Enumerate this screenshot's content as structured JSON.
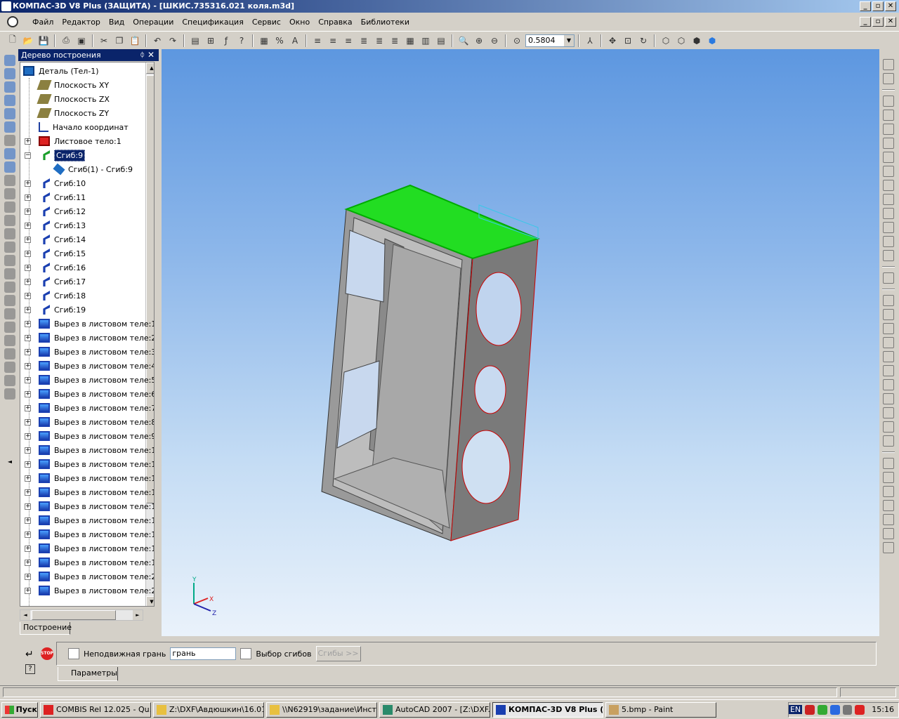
{
  "window": {
    "title": "КОМПАС-3D V8 Plus (ЗАЩИТА) - [ШКИС.735316.021 коля.m3d]",
    "minimize": "_",
    "restore": "▫",
    "close": "✕"
  },
  "menu": [
    "Файл",
    "Редактор",
    "Вид",
    "Операции",
    "Спецификация",
    "Сервис",
    "Окно",
    "Справка",
    "Библиотеки"
  ],
  "toolbar": {
    "zoom_value": "0.5804",
    "icons": [
      "new-icon",
      "open-icon",
      "save-icon",
      "print-icon",
      "preview-icon",
      "cut-icon",
      "copy-icon",
      "paste-icon",
      "undo-icon",
      "redo-icon",
      "properties-icon",
      "tree-icon",
      "variables-icon",
      "help-icon",
      "paste-special-icon",
      "measure-icon",
      "text-icon",
      "zoom-window-icon",
      "zoom-in-icon",
      "zoom-out-icon",
      "zoom-scale-icon",
      "orient-icon",
      "pan-icon",
      "zoom-all-icon",
      "rotate-icon",
      "wireframe-icon",
      "hidden-lines-icon",
      "shaded-icon",
      "shaded-edges-icon"
    ]
  },
  "tree": {
    "title": "Дерево построения",
    "pin": "ᛰ",
    "close": "✕",
    "tab": "Построение",
    "items": [
      {
        "label": "Деталь (Тел-1)",
        "icon": "part",
        "level": 0,
        "exp": ""
      },
      {
        "label": "Плоскость XY",
        "icon": "plane",
        "level": 1,
        "exp": ""
      },
      {
        "label": "Плоскость ZX",
        "icon": "plane",
        "level": 1,
        "exp": ""
      },
      {
        "label": "Плоскость ZY",
        "icon": "plane",
        "level": 1,
        "exp": ""
      },
      {
        "label": "Начало координат",
        "icon": "origin",
        "level": 1,
        "exp": ""
      },
      {
        "label": "Листовое тело:1",
        "icon": "sheet",
        "level": 1,
        "exp": "+"
      },
      {
        "label": "Сгиб:9",
        "icon": "bend-active",
        "level": 1,
        "exp": "−",
        "selected": true
      },
      {
        "label": "Сгиб(1) -  Сгиб:9",
        "icon": "sub",
        "level": 2,
        "exp": ""
      },
      {
        "label": "Сгиб:10",
        "icon": "bend",
        "level": 1,
        "exp": "+"
      },
      {
        "label": "Сгиб:11",
        "icon": "bend",
        "level": 1,
        "exp": "+"
      },
      {
        "label": "Сгиб:12",
        "icon": "bend",
        "level": 1,
        "exp": "+"
      },
      {
        "label": "Сгиб:13",
        "icon": "bend",
        "level": 1,
        "exp": "+"
      },
      {
        "label": "Сгиб:14",
        "icon": "bend",
        "level": 1,
        "exp": "+"
      },
      {
        "label": "Сгиб:15",
        "icon": "bend",
        "level": 1,
        "exp": "+"
      },
      {
        "label": "Сгиб:16",
        "icon": "bend",
        "level": 1,
        "exp": "+"
      },
      {
        "label": "Сгиб:17",
        "icon": "bend",
        "level": 1,
        "exp": "+"
      },
      {
        "label": "Сгиб:18",
        "icon": "bend",
        "level": 1,
        "exp": "+"
      },
      {
        "label": "Сгиб:19",
        "icon": "bend",
        "level": 1,
        "exp": "+"
      },
      {
        "label": "Вырез в листовом теле:1",
        "icon": "cut",
        "level": 1,
        "exp": "+"
      },
      {
        "label": "Вырез в листовом теле:2",
        "icon": "cut",
        "level": 1,
        "exp": "+"
      },
      {
        "label": "Вырез в листовом теле:3",
        "icon": "cut",
        "level": 1,
        "exp": "+"
      },
      {
        "label": "Вырез в листовом теле:4",
        "icon": "cut",
        "level": 1,
        "exp": "+"
      },
      {
        "label": "Вырез в листовом теле:5",
        "icon": "cut",
        "level": 1,
        "exp": "+"
      },
      {
        "label": "Вырез в листовом теле:6",
        "icon": "cut",
        "level": 1,
        "exp": "+"
      },
      {
        "label": "Вырез в листовом теле:7",
        "icon": "cut",
        "level": 1,
        "exp": "+"
      },
      {
        "label": "Вырез в листовом теле:8",
        "icon": "cut",
        "level": 1,
        "exp": "+"
      },
      {
        "label": "Вырез в листовом теле:9",
        "icon": "cut",
        "level": 1,
        "exp": "+"
      },
      {
        "label": "Вырез в листовом теле:1",
        "icon": "cut",
        "level": 1,
        "exp": "+"
      },
      {
        "label": "Вырез в листовом теле:1",
        "icon": "cut",
        "level": 1,
        "exp": "+"
      },
      {
        "label": "Вырез в листовом теле:1",
        "icon": "cut",
        "level": 1,
        "exp": "+"
      },
      {
        "label": "Вырез в листовом теле:1",
        "icon": "cut",
        "level": 1,
        "exp": "+"
      },
      {
        "label": "Вырез в листовом теле:1",
        "icon": "cut",
        "level": 1,
        "exp": "+"
      },
      {
        "label": "Вырез в листовом теле:1",
        "icon": "cut",
        "level": 1,
        "exp": "+"
      },
      {
        "label": "Вырез в листовом теле:1",
        "icon": "cut",
        "level": 1,
        "exp": "+"
      },
      {
        "label": "Вырез в листовом теле:1",
        "icon": "cut",
        "level": 1,
        "exp": "+"
      },
      {
        "label": "Вырез в листовом теле:1",
        "icon": "cut",
        "level": 1,
        "exp": "+"
      },
      {
        "label": "Вырез в листовом теле:2",
        "icon": "cut",
        "level": 1,
        "exp": "+"
      },
      {
        "label": "Вырез в листовом теле:2",
        "icon": "cut",
        "level": 1,
        "exp": "+"
      }
    ]
  },
  "axes": {
    "x": "X",
    "y": "Y",
    "z": "Z"
  },
  "props": {
    "fixed_face_label": "Неподвижная грань",
    "fixed_face_value": "грань",
    "bend_select_label": "Выбор сгибов",
    "bends_button": "Сгибы  >>",
    "tab": "Параметры"
  },
  "taskbar": {
    "start": "Пуск",
    "tasks": [
      {
        "label": "COMBIS Rel 12.025 - Qu...",
        "color": "#d22"
      },
      {
        "label": "Z:\\DXF\\Авдюшкин\\16.01",
        "color": "#e8c040"
      },
      {
        "label": "\\\\N62919\\задание\\Инст...",
        "color": "#e8c040"
      },
      {
        "label": "AutoCAD 2007 - [Z:\\DXF...",
        "color": "#2a8a6a"
      },
      {
        "label": "КОМПАС-3D V8 Plus (...",
        "color": "#1a3fb0",
        "active": true
      },
      {
        "label": "5.bmp - Paint",
        "color": "#c8a060"
      }
    ],
    "lang": "EN",
    "clock": "15:16"
  }
}
